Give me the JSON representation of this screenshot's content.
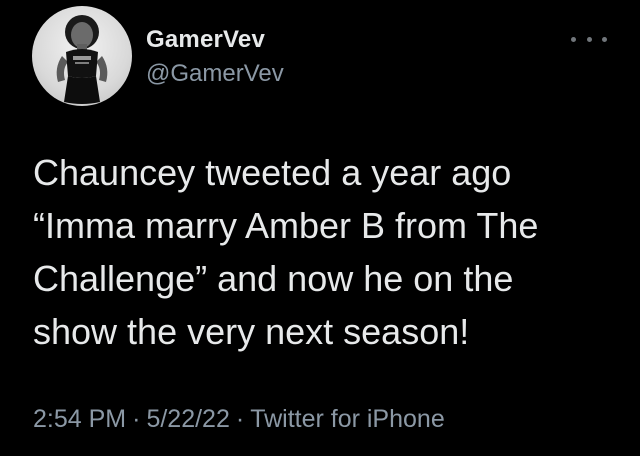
{
  "author": {
    "display_name": "GamerVev",
    "handle": "@GamerVev",
    "avatar_icon": "avatar-photo"
  },
  "menu": {
    "icon": "more-horizontal-icon"
  },
  "tweet": {
    "text": "Chauncey tweeted a year ago\n“Imma marry Amber B from The\nChallenge” and now he on the\nshow the very next season!"
  },
  "meta": {
    "time": "2:54 PM",
    "separator": "·",
    "date": "5/22/22",
    "source": "Twitter for iPhone"
  },
  "colors": {
    "background": "#000000",
    "primary_text": "#e7e9ea",
    "secondary_text": "#8b98a5"
  }
}
